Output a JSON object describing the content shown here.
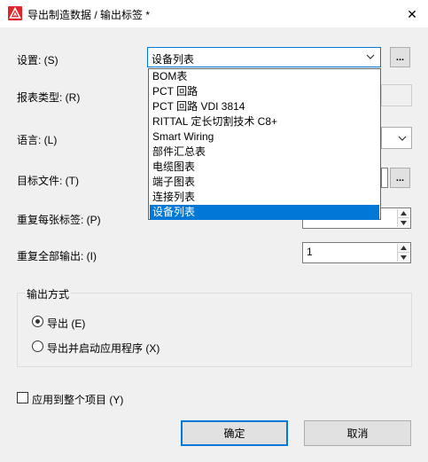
{
  "window": {
    "title": "导出制造数据 / 输出标签 *",
    "close_glyph": "✕"
  },
  "form": {
    "settings_label": "设置: (S)",
    "settings_value": "设备列表",
    "settings_dots": "...",
    "report_type_label": "报表类型: (R)",
    "language_label": "语言: (L)",
    "target_file_label": "目标文件: (T)",
    "target_dots": "...",
    "repeat_each_label": "重复每张标签: (P)",
    "repeat_all_label": "重复全部输出: (I)",
    "repeat_all_value": "1"
  },
  "dropdown": {
    "items": [
      "BOM表",
      "PCT 回路",
      "PCT 回路 VDI 3814",
      "RITTAL 定长切割技术 C8+",
      "Smart Wiring",
      "部件汇总表",
      "电缆图表",
      "端子图表",
      "连接列表",
      "设备列表"
    ],
    "selected_index": 9
  },
  "output_mode": {
    "group_title": "输出方式",
    "option_export": "导出 (E)",
    "option_export_launch": "导出并启动应用程序 (X)",
    "selected": "export"
  },
  "apply_whole_project": {
    "label": "应用到整个项目 (Y)",
    "checked": false
  },
  "buttons": {
    "ok": "确定",
    "cancel": "取消"
  },
  "colors": {
    "accent": "#0078d7",
    "app_icon_red": "#e0262d"
  }
}
